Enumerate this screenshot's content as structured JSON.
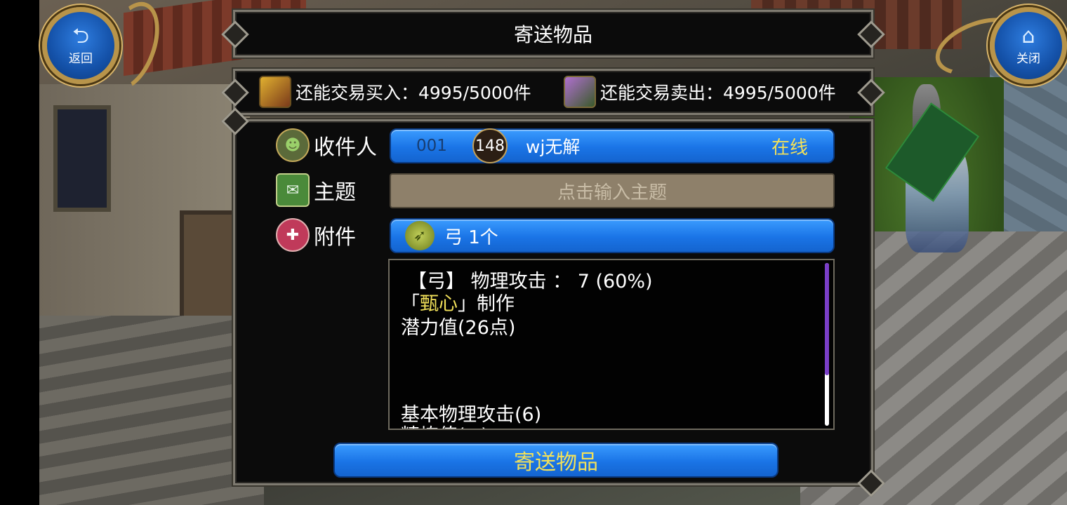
{
  "nav": {
    "back_icon": "back-arrow-icon",
    "back_label": "返回",
    "close_icon": "home-icon",
    "close_label": "关闭"
  },
  "title": "寄送物品",
  "quota": {
    "buy_text": "还能交易买入：4995/5000件",
    "sell_text": "还能交易卖出：4995/5000件"
  },
  "form": {
    "recipient_label": "收件人",
    "recipient": {
      "id": "001",
      "level": "148",
      "name": "wj无解",
      "status": "在线"
    },
    "subject_label": "主题",
    "subject_placeholder": "点击输入主题",
    "attach_label": "附件",
    "attachment": {
      "icon": "bow-icon",
      "name": "弓 1个"
    }
  },
  "description": {
    "line1": "【弓】 物理攻击 ：  7 (60%)",
    "maker_open": "「",
    "maker_name": "甄心",
    "maker_close": "」制作",
    "line3": "潜力值(26点)",
    "line4": "基本物理攻击(6)",
    "line5": "精炼值(+)"
  },
  "send_button": "寄送物品",
  "colors": {
    "button_blue": "#1a74e6",
    "highlight_yellow": "#f2e15a",
    "panel_black": "#0b0b0b"
  }
}
